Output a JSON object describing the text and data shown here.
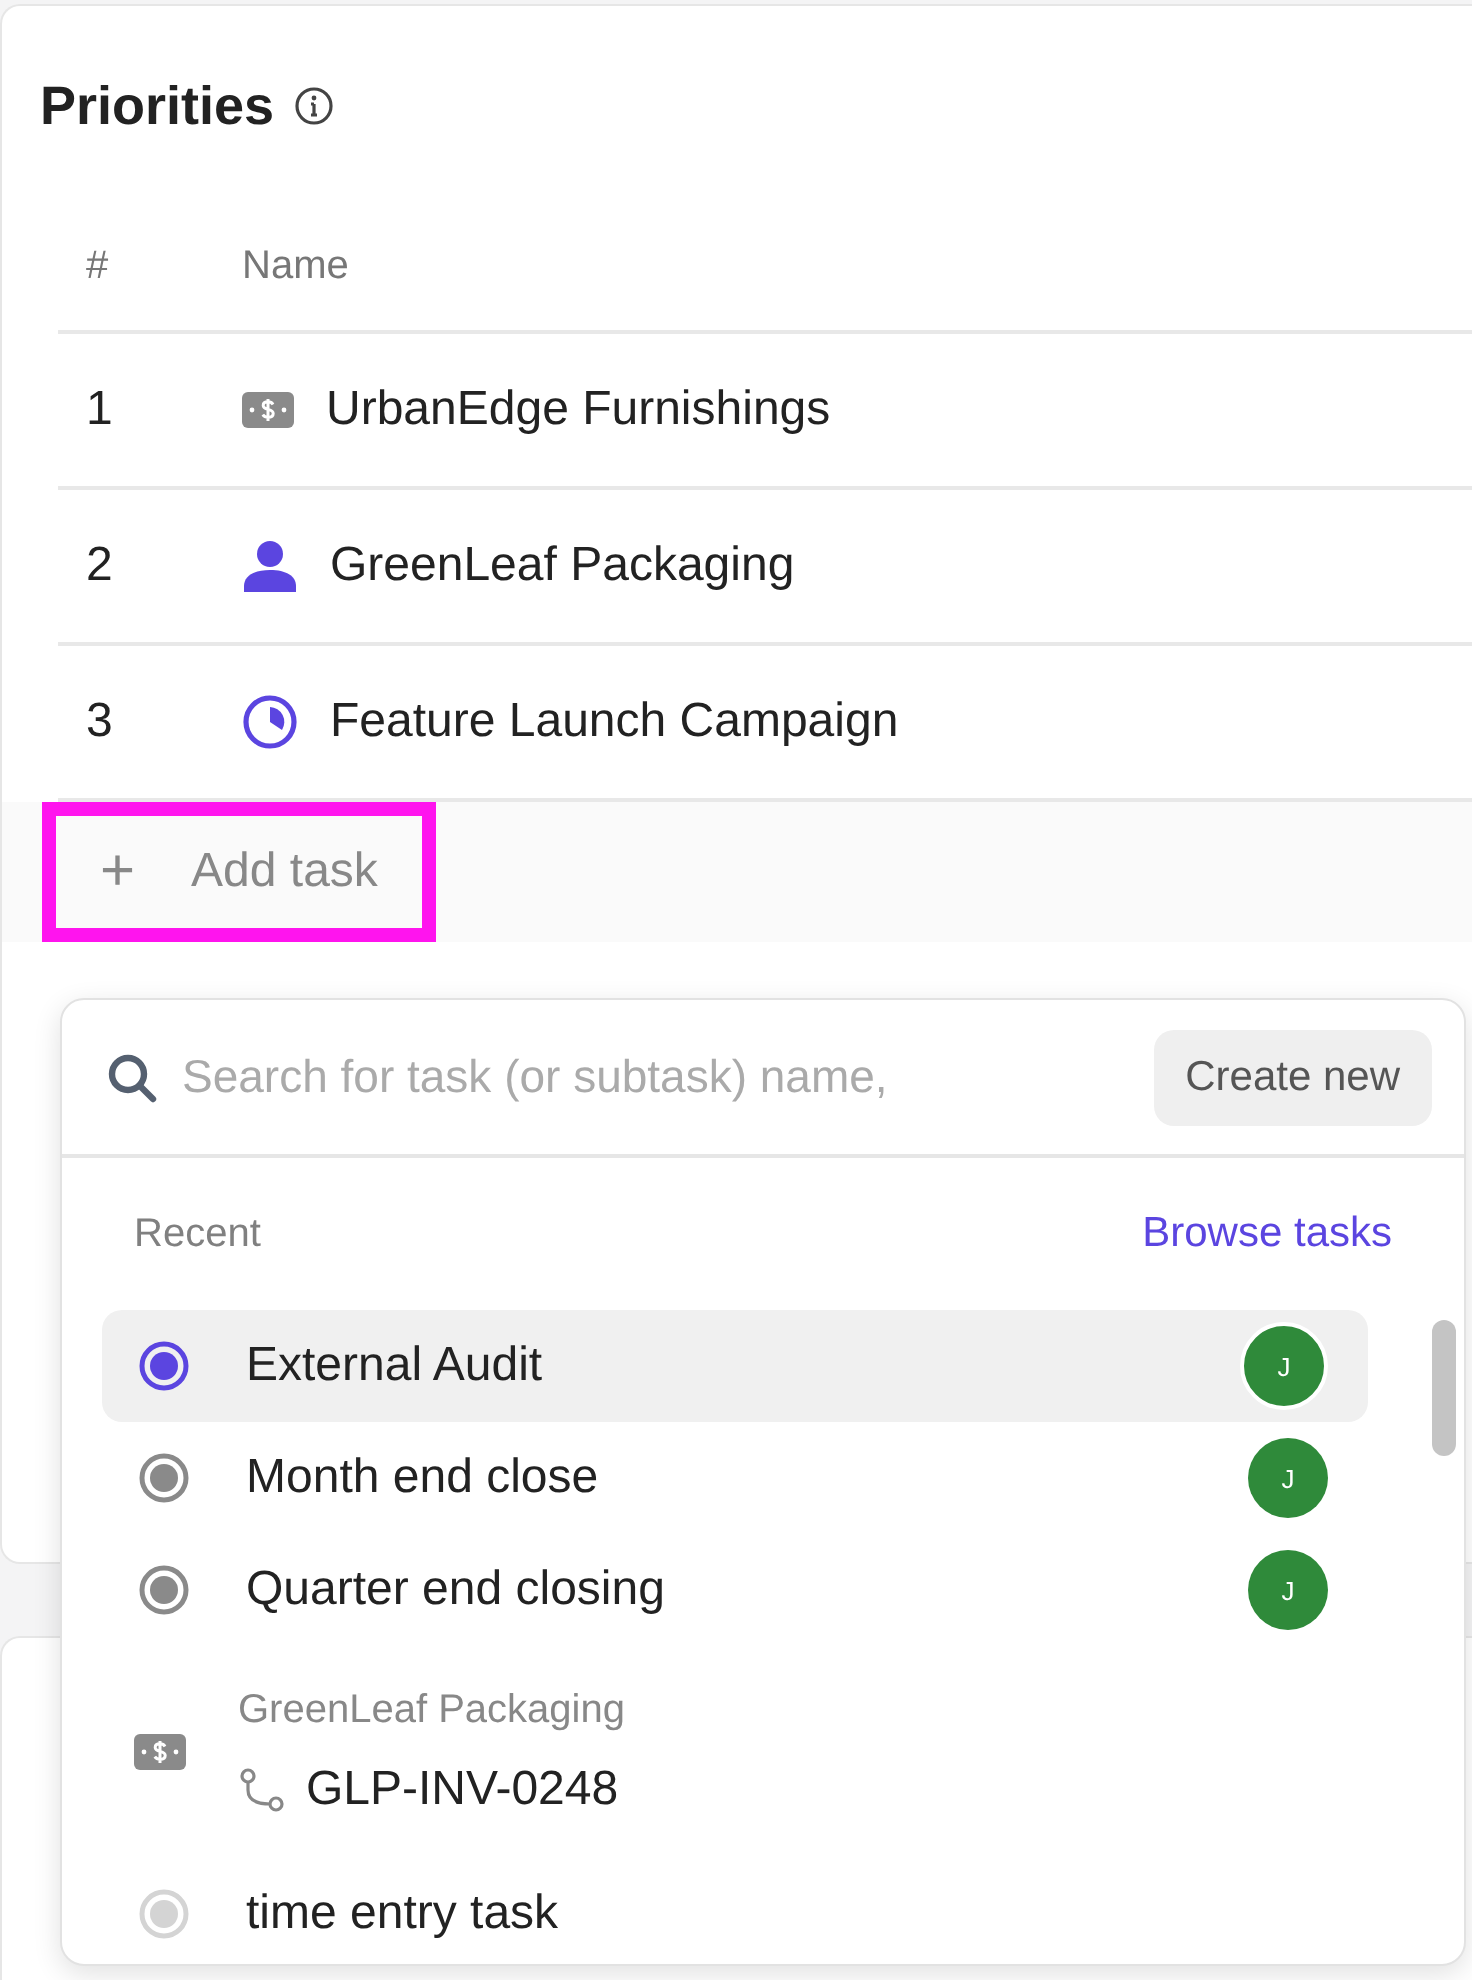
{
  "priorities": {
    "title": "Priorities",
    "columns": [
      "#",
      "Name"
    ],
    "rows": [
      {
        "number": "1",
        "kind": "money",
        "name": "UrbanEdge Furnishings"
      },
      {
        "number": "2",
        "kind": "person",
        "name": "GreenLeaf Packaging"
      },
      {
        "number": "3",
        "kind": "progress",
        "name": "Feature Launch Campaign"
      }
    ],
    "add_task": {
      "icon": "+",
      "label": "Add task",
      "highlighted": true
    }
  },
  "task_picker": {
    "search": {
      "placeholder": "Search for task (or subtask) name,"
    },
    "create_button": "Create new",
    "section": "Recent",
    "browse_link": "Browse tasks",
    "items": [
      {
        "kind": "task",
        "name": "External Audit",
        "color": "#5b45e0",
        "assignee": "J",
        "selected": true
      },
      {
        "kind": "task",
        "name": "Month end close",
        "color": "#8a8a8a",
        "assignee": "J",
        "selected": false
      },
      {
        "kind": "task",
        "name": "Quarter end closing",
        "color": "#8a8a8a",
        "assignee": "J",
        "selected": false
      },
      {
        "kind": "subtask",
        "parent": "GreenLeaf Packaging",
        "name": "GLP-INV-0248",
        "selected": false
      },
      {
        "kind": "task",
        "name": "time entry task",
        "color": "#d4d4d4",
        "selected": false
      }
    ]
  }
}
